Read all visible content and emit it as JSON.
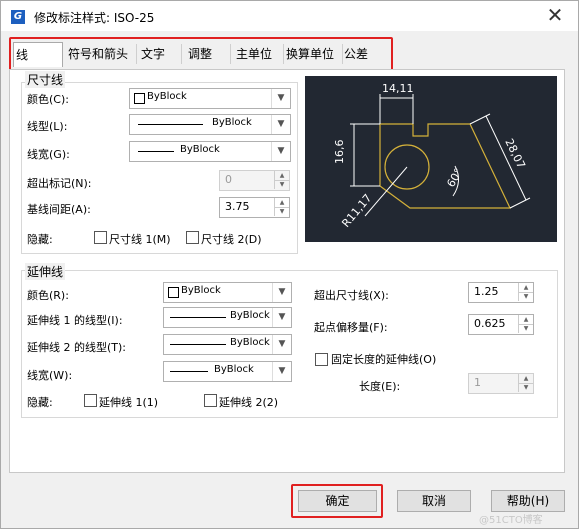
{
  "window": {
    "title": "修改标注样式: ISO-25",
    "icon": "G"
  },
  "tabs": [
    {
      "label": "线"
    },
    {
      "label": "符号和箭头"
    },
    {
      "label": "文字"
    },
    {
      "label": "调整"
    },
    {
      "label": "主单位"
    },
    {
      "label": "换算单位"
    },
    {
      "label": "公差"
    }
  ],
  "dim_lines": {
    "group_title": "尺寸线",
    "color_label": "颜色(C):",
    "color_value": "ByBlock",
    "linetype_label": "线型(L):",
    "linetype_value": "ByBlock",
    "lineweight_label": "线宽(G):",
    "lineweight_value": "ByBlock",
    "extend_ticks_label": "超出标记(N):",
    "extend_ticks_value": "0",
    "baseline_label": "基线间距(A):",
    "baseline_value": "3.75",
    "suppress_label": "隐藏:",
    "suppress1_label": "尺寸线 1(M)",
    "suppress2_label": "尺寸线 2(D)"
  },
  "preview": {
    "dim_top": "14,11",
    "dim_left": "16,6",
    "dim_right": "28,07",
    "dim_angle": "60°",
    "dim_radius": "R11,17"
  },
  "ext_lines": {
    "group_title": "延伸线",
    "color_label": "颜色(R):",
    "color_value": "ByBlock",
    "lt1_label": "延伸线 1 的线型(I):",
    "lt1_value": "ByBlock",
    "lt2_label": "延伸线 2 的线型(T):",
    "lt2_value": "ByBlock",
    "lineweight_label": "线宽(W):",
    "lineweight_value": "ByBlock",
    "suppress_label": "隐藏:",
    "suppress1_label": "延伸线 1(1)",
    "suppress2_label": "延伸线 2(2)",
    "beyond_label": "超出尺寸线(X):",
    "beyond_value": "1.25",
    "offset_label": "起点偏移量(F):",
    "offset_value": "0.625",
    "fixed_label": "固定长度的延伸线(O)",
    "length_label": "长度(E):",
    "length_value": "1"
  },
  "buttons": {
    "ok": "确定",
    "cancel": "取消",
    "help": "帮助(H)"
  },
  "watermark": "@51CTO博客",
  "colors": {
    "highlight": "#e02020",
    "preview_bg": "#222832",
    "preview_geom": "#d4b13a"
  }
}
